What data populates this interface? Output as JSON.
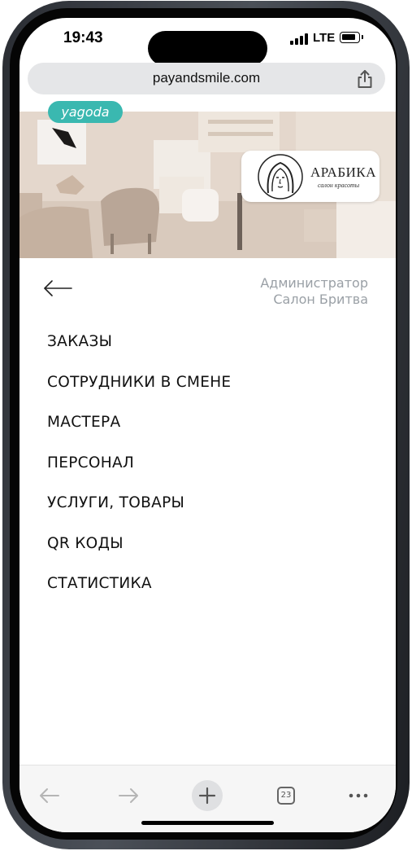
{
  "status_bar": {
    "time": "19:43",
    "network": "LTE"
  },
  "browser": {
    "url": "payandsmile.com",
    "tab_count": "23"
  },
  "banner": {
    "brand": "yagoda",
    "salon_logo_name": "АРАБИКА",
    "salon_logo_subtitle": "салон красоты"
  },
  "header": {
    "role_line1": "Администратор",
    "role_line2": "Салон Бритва"
  },
  "menu": [
    {
      "label": "ЗАКАЗЫ"
    },
    {
      "label": "СОТРУДНИКИ В СМЕНЕ"
    },
    {
      "label": "МАСТЕРА"
    },
    {
      "label": "ПЕРСОНАЛ"
    },
    {
      "label": "УСЛУГИ, ТОВАРЫ"
    },
    {
      "label": "QR КОДЫ"
    },
    {
      "label": "СТАТИСТИКА"
    }
  ],
  "colors": {
    "brand_teal": "#3ab8b0",
    "role_text": "#9aa0a6",
    "toolbar_bg": "#f6f6f6"
  },
  "icons": [
    "back-arrow-icon",
    "share-icon",
    "nav-back-icon",
    "nav-forward-icon",
    "new-tab-icon",
    "tabs-icon",
    "more-icon"
  ]
}
